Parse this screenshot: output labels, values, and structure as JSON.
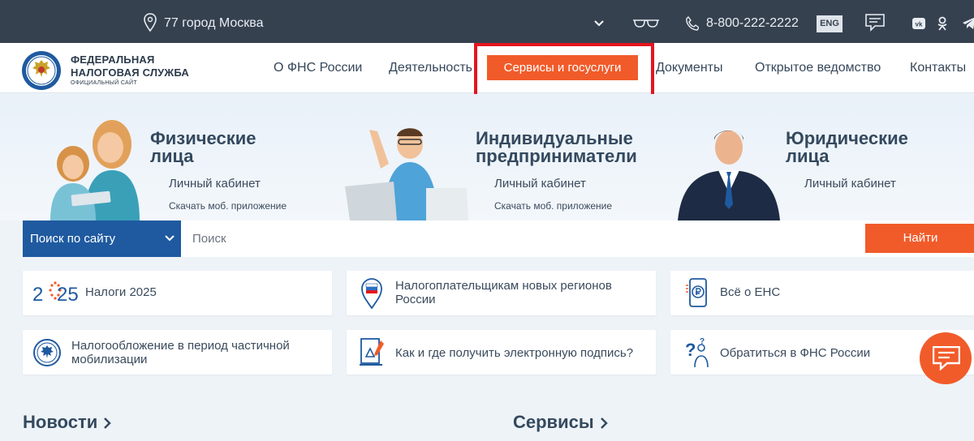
{
  "topbar": {
    "city": "77 город Москва",
    "phone": "8-800-222-2222",
    "lang": "ENG",
    "icons": [
      "location-pin-icon",
      "chevron-down-icon",
      "glasses-icon",
      "phone-icon",
      "chat-icon",
      "vk-icon",
      "ok-icon",
      "telegram-icon"
    ]
  },
  "header": {
    "logo_line1": "ФЕДЕРАЛЬНАЯ",
    "logo_line2": "НАЛОГОВАЯ СЛУЖБА",
    "logo_line3": "ОФИЦИАЛЬНЫЙ САЙТ",
    "nav": [
      {
        "label": "О ФНС России"
      },
      {
        "label": "Деятельность"
      },
      {
        "label": "Сервисы и госуслуги",
        "active": true
      },
      {
        "label": "Документы"
      },
      {
        "label": "Открытое ведомство"
      },
      {
        "label": "Контакты"
      }
    ]
  },
  "hero": {
    "individuals": {
      "title1": "Физические",
      "title2": "лица",
      "link": "Личный кабинет",
      "app": "Скачать моб. приложение"
    },
    "entrepreneurs": {
      "title1": "Индивидуальные",
      "title2": "предприниматели",
      "link": "Личный кабинет",
      "app": "Скачать моб. приложение"
    },
    "legal": {
      "title1": "Юридические",
      "title2": "лица",
      "link": "Личный кабинет"
    }
  },
  "search": {
    "scope": "Поиск по сайту",
    "placeholder": "Поиск",
    "button": "Найти"
  },
  "cards": [
    {
      "label": "Налоги 2025",
      "icon": "year-2025-icon",
      "year_left": "2",
      "year_right": "25"
    },
    {
      "label": "Налогоплательщикам новых регионов России",
      "icon": "russia-flag-pin-icon"
    },
    {
      "label": "Всё о ЕНС",
      "icon": "ruble-phone-icon"
    },
    {
      "label": "Налогообложение в период частичной мобилизации",
      "icon": "emblem-icon"
    },
    {
      "label": "Как и где получить электронную подпись?",
      "icon": "e-signature-icon"
    },
    {
      "label": "Обратиться в ФНС России",
      "icon": "question-person-icon"
    }
  ],
  "sections": {
    "news": "Новости",
    "services": "Сервисы"
  },
  "colors": {
    "topbar": "#364150",
    "accent": "#f15b2a",
    "search_select": "#1f5aa0",
    "highlight_frame": "#e3151f"
  }
}
